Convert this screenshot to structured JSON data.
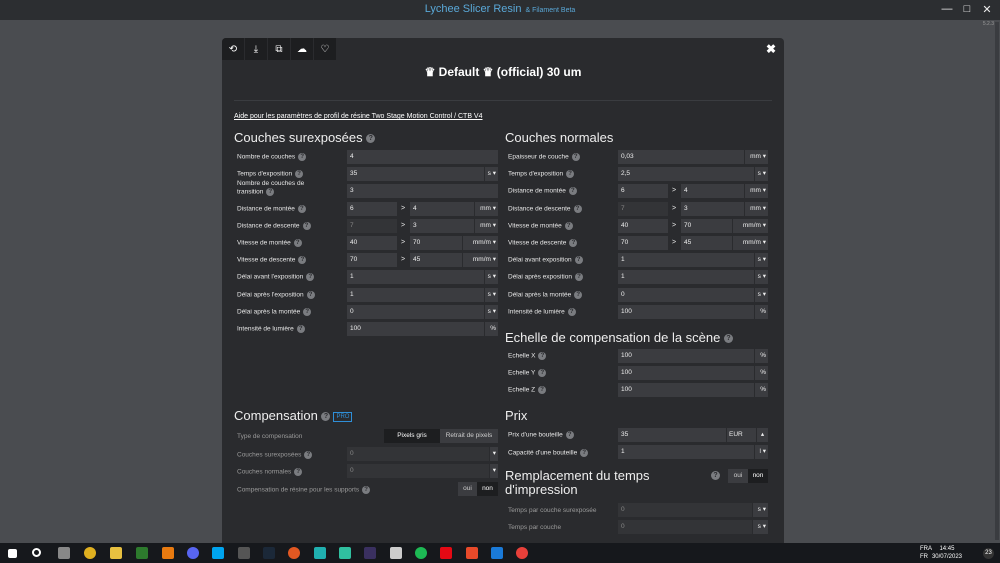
{
  "app": {
    "title": "Lychee Slicer Resin",
    "subtitle": "& Filament Beta",
    "version": "5.2.3"
  },
  "window": {
    "min": "—",
    "max": "□",
    "close": "✕"
  },
  "dialog": {
    "title": "♛ Default ♛ (official) 30 um",
    "close": "✖",
    "help_link": "Aide pour les paramètres de profil de résine Two Stage Motion Control / CTB V4",
    "toolbar": [
      "history-icon",
      "download-icon",
      "copy-icon",
      "cloud-icon",
      "heart-icon"
    ]
  },
  "over": {
    "title": "Couches surexposées",
    "rows": [
      {
        "label": "Nombre de couches",
        "value": "4"
      },
      {
        "label": "Temps d'exposition",
        "value": "35",
        "unit": "s"
      },
      {
        "label": "Nombre de couches de transition",
        "value": "3"
      },
      {
        "label": "Distance de montée",
        "value": "6",
        "value2": "4",
        "unit": "mm"
      },
      {
        "label": "Distance de descente",
        "value": "7",
        "value2": "3",
        "unit": "mm"
      },
      {
        "label": "Vitesse de montée",
        "value": "40",
        "value2": "70",
        "unit": "mm/m"
      },
      {
        "label": "Vitesse de descente",
        "value": "70",
        "value2": "45",
        "unit": "mm/m"
      },
      {
        "label": "Délai avant l'exposition",
        "value": "1",
        "unit": "s"
      },
      {
        "label": "Délai après l'exposition",
        "value": "1",
        "unit": "s"
      },
      {
        "label": "Délai après la montée",
        "value": "0",
        "unit": "s"
      },
      {
        "label": "Intensité de lumière",
        "value": "100",
        "unit": "%"
      }
    ]
  },
  "normal": {
    "title": "Couches normales",
    "rows": [
      {
        "label": "Epaisseur de couche",
        "value": "0,03",
        "unit": "mm"
      },
      {
        "label": "Temps d'exposition",
        "value": "2,5",
        "unit": "s"
      },
      {
        "label": "Distance de montée",
        "value": "6",
        "value2": "4",
        "unit": "mm"
      },
      {
        "label": "Distance de descente",
        "value": "7",
        "value2": "3",
        "unit": "mm"
      },
      {
        "label": "Vitesse de montée",
        "value": "40",
        "value2": "70",
        "unit": "mm/m"
      },
      {
        "label": "Vitesse de descente",
        "value": "70",
        "value2": "45",
        "unit": "mm/m"
      },
      {
        "label": "Délai avant exposition",
        "value": "1",
        "unit": "s"
      },
      {
        "label": "Délai après exposition",
        "value": "1",
        "unit": "s"
      },
      {
        "label": "Délai après la montée",
        "value": "0",
        "unit": "s"
      },
      {
        "label": "Intensité de lumière",
        "value": "100",
        "unit": "%"
      }
    ]
  },
  "scene": {
    "title": "Echelle de compensation de la scène",
    "rows": [
      {
        "label": "Echelle X",
        "value": "100",
        "unit": "%"
      },
      {
        "label": "Echelle Y",
        "value": "100",
        "unit": "%"
      },
      {
        "label": "Echelle Z",
        "value": "100",
        "unit": "%"
      }
    ]
  },
  "compensation": {
    "title": "Compensation",
    "badge": "PRO",
    "type_label": "Type de compensation",
    "opt1": "Pixels gris",
    "opt2": "Retrait de pixels",
    "over_label": "Couches surexposées",
    "over_value": "0",
    "normal_label": "Couches normales",
    "normal_value": "0",
    "support_label": "Compensation de résine pour les supports",
    "yes": "oui",
    "no": "non"
  },
  "price": {
    "title": "Prix",
    "bottle_label": "Prix d'une bouteille",
    "bottle_value": "35",
    "currency": "EUR",
    "capacity_label": "Capacité d'une bouteille",
    "capacity_value": "1",
    "capacity_unit": "l"
  },
  "replace": {
    "title": "Remplacement du temps d'impression",
    "yes": "oui",
    "no": "non",
    "over_label": "Temps par couche surexposée",
    "over_value": "0",
    "over_unit": "s",
    "normal_label": "Temps par couche",
    "normal_value": "0",
    "normal_unit": "s"
  },
  "taskbar": {
    "lang1": "FRA",
    "lang2": "FR",
    "time": "14:45",
    "date": "30/07/2023",
    "notif": "23"
  }
}
